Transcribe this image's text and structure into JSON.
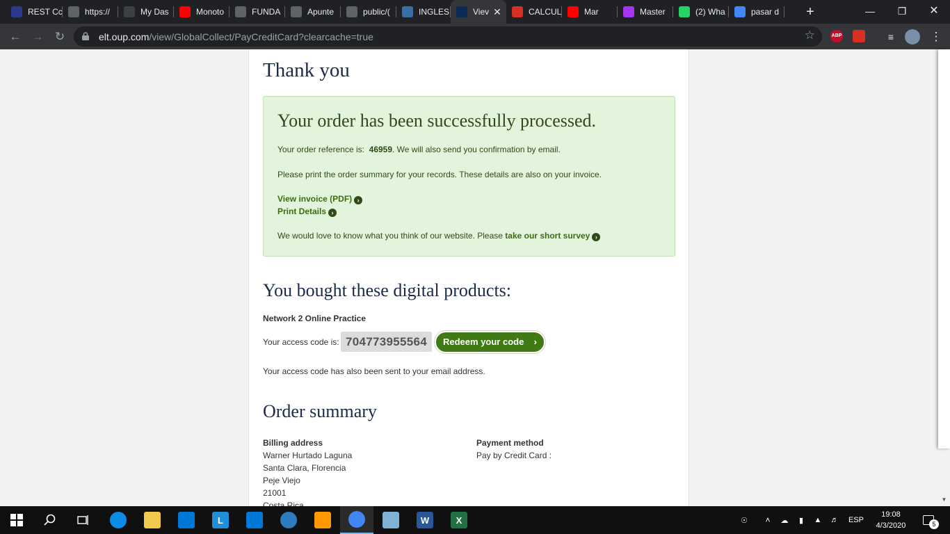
{
  "browser": {
    "tabs": [
      {
        "label": "REST Cc",
        "icon": "rc-icon",
        "color": "#2b3a8f"
      },
      {
        "label": "https://",
        "icon": "globe-icon",
        "color": "#5f6368"
      },
      {
        "label": "My Das",
        "icon": "globe-icon",
        "color": "#3c4043"
      },
      {
        "label": "Monoto",
        "icon": "youtube-icon",
        "color": "#ff0000"
      },
      {
        "label": "FUNDA",
        "icon": "globe-icon",
        "color": "#5f6368"
      },
      {
        "label": "Apunte",
        "icon": "globe-icon",
        "color": "#5f6368"
      },
      {
        "label": "public/(",
        "icon": "globe-icon",
        "color": "#5f6368"
      },
      {
        "label": "INGLES",
        "icon": "td-icon",
        "color": "#3a6ea5"
      },
      {
        "label": "Viev",
        "icon": "oxford-icon",
        "color": "#0b2a57",
        "active": true
      },
      {
        "label": "CALCUL",
        "icon": "gmail-icon",
        "color": "#d93025"
      },
      {
        "label": "Mar",
        "icon": "youtube-icon",
        "color": "#ff0000"
      },
      {
        "label": "Master",
        "icon": "udemy-icon",
        "color": "#a435f0"
      },
      {
        "label": "(2) Wha",
        "icon": "whatsapp-icon",
        "color": "#25d366"
      },
      {
        "label": "pasar d",
        "icon": "google-icon",
        "color": "#4285f4"
      }
    ],
    "new_tab": "+",
    "url_host": "elt.oup.com",
    "url_path": "/view/GlobalCollect/PayCreditCard?clearcache=true",
    "extensions": [
      {
        "label": "ABP",
        "icon": "adblock-plus-icon",
        "color": "#c70d2c"
      },
      {
        "label": "",
        "icon": "shield-extension-icon",
        "color": "#d93025"
      }
    ]
  },
  "page": {
    "thank_you": "Thank you",
    "success_heading": "Your order has been successfully processed.",
    "order_ref_prefix": "Your order reference is:",
    "order_ref": "46959",
    "order_ref_suffix": ". We will also send you confirmation by email.",
    "print_note": "Please print the order summary for your records. These details are also on your invoice.",
    "view_invoice": "View invoice (PDF)",
    "print_details": "Print Details",
    "survey_prefix": "We would love to know what you think of our website. Please",
    "survey_link": "take our short survey",
    "bought_heading": "You bought these digital products:",
    "product_name": "Network 2 Online Practice",
    "access_code_label": "Your access code is:",
    "access_code": "704773955564",
    "redeem_button": "Redeem your code",
    "email_note": "Your access code has also been sent to your email address.",
    "summary_heading": "Order summary",
    "billing": {
      "title": "Billing address",
      "lines": [
        "Warner Hurtado Laguna",
        "Santa Clara, Florencia",
        "Peje Viejo",
        "21001",
        "Costa Rica"
      ]
    },
    "payment": {
      "title": "Payment method",
      "value": "Pay by Credit Card :"
    }
  },
  "taskbar": {
    "apps": [
      {
        "icon": "edge-icon",
        "color": "#0c8ce9"
      },
      {
        "icon": "file-explorer-icon",
        "color": "#f2c94c"
      },
      {
        "icon": "microsoft-store-icon",
        "color": "#0078d7"
      },
      {
        "icon": "l-app-icon",
        "color": "#1f8fd8",
        "glyph": "L"
      },
      {
        "icon": "mail-icon",
        "color": "#0078d7"
      },
      {
        "icon": "webcam-app-icon",
        "color": "#2c7dbf"
      },
      {
        "icon": "sublime-text-icon",
        "color": "#ff9800"
      },
      {
        "icon": "chrome-icon",
        "color": "#4285f4",
        "active": true
      },
      {
        "icon": "notepad-icon",
        "color": "#7fb3d5"
      },
      {
        "icon": "word-icon",
        "color": "#2b579a",
        "glyph": "W"
      },
      {
        "icon": "excel-icon",
        "color": "#217346",
        "glyph": "X"
      }
    ],
    "language": "ESP",
    "time": "19:08",
    "date": "4/3/2020",
    "notification_count": "5"
  }
}
